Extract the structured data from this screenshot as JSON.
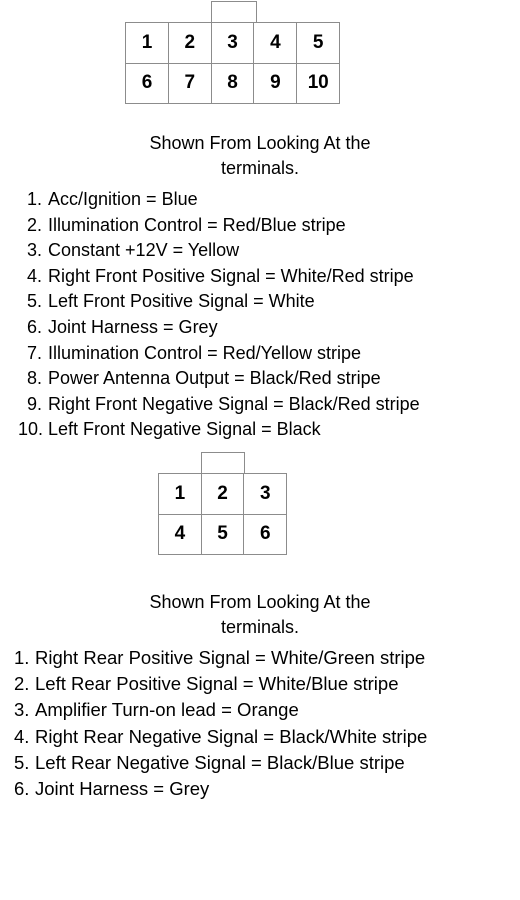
{
  "connectors": [
    {
      "name": "front-harness-connector",
      "tab_label": "",
      "columns": 5,
      "rows": 2,
      "pins": [
        "1",
        "2",
        "3",
        "4",
        "5",
        "6",
        "7",
        "8",
        "9",
        "10"
      ],
      "caption_line1": "Shown From Looking At the",
      "caption_line2": "terminals.",
      "pinout": [
        {
          "number": "1.",
          "description": "Acc/Ignition = Blue"
        },
        {
          "number": "2.",
          "description": "Illumination Control = Red/Blue stripe"
        },
        {
          "number": "3.",
          "description": "Constant +12V = Yellow"
        },
        {
          "number": "4.",
          "description": "Right Front Positive Signal = White/Red stripe"
        },
        {
          "number": "5.",
          "description": "Left Front Positive Signal = White"
        },
        {
          "number": "6.",
          "description": "Joint Harness = Grey"
        },
        {
          "number": "7.",
          "description": "Illumination Control = Red/Yellow stripe"
        },
        {
          "number": "8.",
          "description": "Power Antenna Output = Black/Red stripe"
        },
        {
          "number": "9.",
          "description": "Right Front Negative Signal = Black/Red stripe"
        },
        {
          "number": "10.",
          "description": "Left Front Negative Signal = Black"
        }
      ]
    },
    {
      "name": "rear-harness-connector",
      "tab_label": "",
      "columns": 3,
      "rows": 2,
      "pins": [
        "1",
        "2",
        "3",
        "4",
        "5",
        "6"
      ],
      "caption_line1": "Shown From Looking At the",
      "caption_line2": "terminals.",
      "pinout": [
        {
          "number": "1.",
          "description": "Right Rear Positive Signal = White/Green stripe"
        },
        {
          "number": "2.",
          "description": "Left Rear Positive Signal = White/Blue stripe"
        },
        {
          "number": "3.",
          "description": "Amplifier Turn-on lead = Orange"
        },
        {
          "number": "4.",
          "description": "Right Rear Negative Signal = Black/White stripe"
        },
        {
          "number": "5.",
          "description": "Left Rear Negative Signal = Black/Blue stripe"
        },
        {
          "number": "6.",
          "description": "Joint Harness = Grey"
        }
      ]
    }
  ],
  "colors": {
    "background": "#ffffff",
    "text": "#000000",
    "connector_border": "#8c8c8c"
  }
}
